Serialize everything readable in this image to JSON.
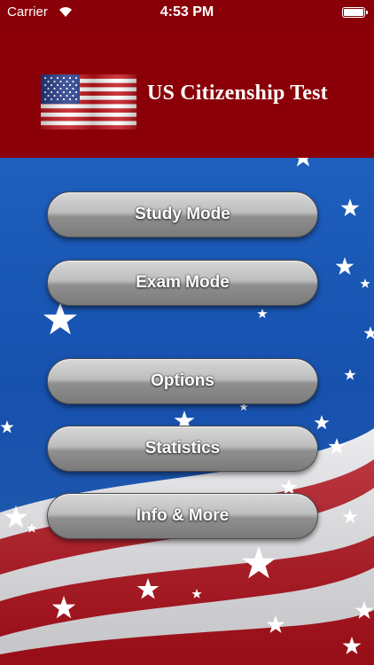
{
  "status_bar": {
    "carrier": "Carrier",
    "time": "4:53 PM",
    "battery_level": 0.9
  },
  "header": {
    "title": "US Citizenship Test",
    "flag_icon": "us-flag-icon",
    "background_color": "#8b0008"
  },
  "menu": {
    "study_mode": "Study Mode",
    "exam_mode": "Exam Mode",
    "options": "Options",
    "statistics": "Statistics",
    "info_more": "Info & More"
  },
  "colors": {
    "background_blue": "#1e5fbd",
    "stripe_red": "#b20f1a",
    "button_gray": "#9a9a9a"
  }
}
